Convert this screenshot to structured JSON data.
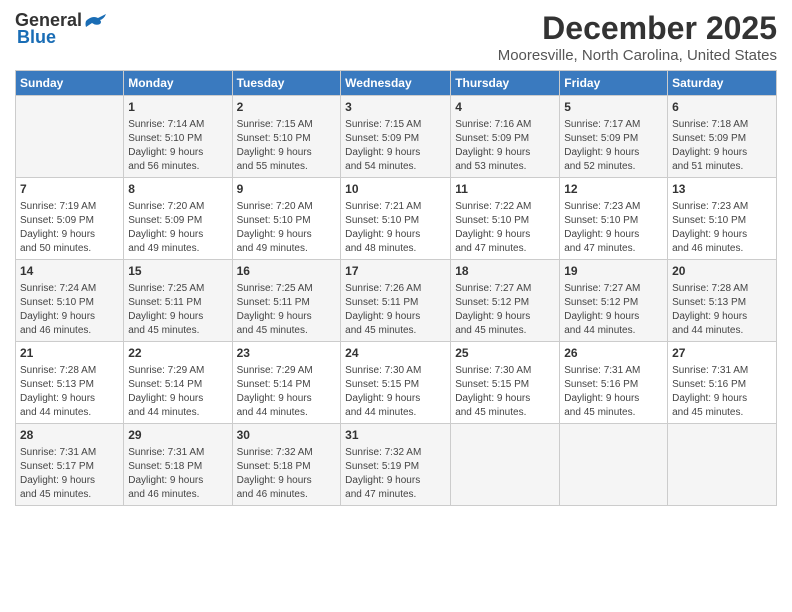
{
  "header": {
    "logo_general": "General",
    "logo_blue": "Blue",
    "month_title": "December 2025",
    "location": "Mooresville, North Carolina, United States"
  },
  "days_of_week": [
    "Sunday",
    "Monday",
    "Tuesday",
    "Wednesday",
    "Thursday",
    "Friday",
    "Saturday"
  ],
  "weeks": [
    [
      {
        "day": "",
        "info": ""
      },
      {
        "day": "1",
        "info": "Sunrise: 7:14 AM\nSunset: 5:10 PM\nDaylight: 9 hours\nand 56 minutes."
      },
      {
        "day": "2",
        "info": "Sunrise: 7:15 AM\nSunset: 5:10 PM\nDaylight: 9 hours\nand 55 minutes."
      },
      {
        "day": "3",
        "info": "Sunrise: 7:15 AM\nSunset: 5:09 PM\nDaylight: 9 hours\nand 54 minutes."
      },
      {
        "day": "4",
        "info": "Sunrise: 7:16 AM\nSunset: 5:09 PM\nDaylight: 9 hours\nand 53 minutes."
      },
      {
        "day": "5",
        "info": "Sunrise: 7:17 AM\nSunset: 5:09 PM\nDaylight: 9 hours\nand 52 minutes."
      },
      {
        "day": "6",
        "info": "Sunrise: 7:18 AM\nSunset: 5:09 PM\nDaylight: 9 hours\nand 51 minutes."
      }
    ],
    [
      {
        "day": "7",
        "info": "Sunrise: 7:19 AM\nSunset: 5:09 PM\nDaylight: 9 hours\nand 50 minutes."
      },
      {
        "day": "8",
        "info": "Sunrise: 7:20 AM\nSunset: 5:09 PM\nDaylight: 9 hours\nand 49 minutes."
      },
      {
        "day": "9",
        "info": "Sunrise: 7:20 AM\nSunset: 5:10 PM\nDaylight: 9 hours\nand 49 minutes."
      },
      {
        "day": "10",
        "info": "Sunrise: 7:21 AM\nSunset: 5:10 PM\nDaylight: 9 hours\nand 48 minutes."
      },
      {
        "day": "11",
        "info": "Sunrise: 7:22 AM\nSunset: 5:10 PM\nDaylight: 9 hours\nand 47 minutes."
      },
      {
        "day": "12",
        "info": "Sunrise: 7:23 AM\nSunset: 5:10 PM\nDaylight: 9 hours\nand 47 minutes."
      },
      {
        "day": "13",
        "info": "Sunrise: 7:23 AM\nSunset: 5:10 PM\nDaylight: 9 hours\nand 46 minutes."
      }
    ],
    [
      {
        "day": "14",
        "info": "Sunrise: 7:24 AM\nSunset: 5:10 PM\nDaylight: 9 hours\nand 46 minutes."
      },
      {
        "day": "15",
        "info": "Sunrise: 7:25 AM\nSunset: 5:11 PM\nDaylight: 9 hours\nand 45 minutes."
      },
      {
        "day": "16",
        "info": "Sunrise: 7:25 AM\nSunset: 5:11 PM\nDaylight: 9 hours\nand 45 minutes."
      },
      {
        "day": "17",
        "info": "Sunrise: 7:26 AM\nSunset: 5:11 PM\nDaylight: 9 hours\nand 45 minutes."
      },
      {
        "day": "18",
        "info": "Sunrise: 7:27 AM\nSunset: 5:12 PM\nDaylight: 9 hours\nand 45 minutes."
      },
      {
        "day": "19",
        "info": "Sunrise: 7:27 AM\nSunset: 5:12 PM\nDaylight: 9 hours\nand 44 minutes."
      },
      {
        "day": "20",
        "info": "Sunrise: 7:28 AM\nSunset: 5:13 PM\nDaylight: 9 hours\nand 44 minutes."
      }
    ],
    [
      {
        "day": "21",
        "info": "Sunrise: 7:28 AM\nSunset: 5:13 PM\nDaylight: 9 hours\nand 44 minutes."
      },
      {
        "day": "22",
        "info": "Sunrise: 7:29 AM\nSunset: 5:14 PM\nDaylight: 9 hours\nand 44 minutes."
      },
      {
        "day": "23",
        "info": "Sunrise: 7:29 AM\nSunset: 5:14 PM\nDaylight: 9 hours\nand 44 minutes."
      },
      {
        "day": "24",
        "info": "Sunrise: 7:30 AM\nSunset: 5:15 PM\nDaylight: 9 hours\nand 44 minutes."
      },
      {
        "day": "25",
        "info": "Sunrise: 7:30 AM\nSunset: 5:15 PM\nDaylight: 9 hours\nand 45 minutes."
      },
      {
        "day": "26",
        "info": "Sunrise: 7:31 AM\nSunset: 5:16 PM\nDaylight: 9 hours\nand 45 minutes."
      },
      {
        "day": "27",
        "info": "Sunrise: 7:31 AM\nSunset: 5:16 PM\nDaylight: 9 hours\nand 45 minutes."
      }
    ],
    [
      {
        "day": "28",
        "info": "Sunrise: 7:31 AM\nSunset: 5:17 PM\nDaylight: 9 hours\nand 45 minutes."
      },
      {
        "day": "29",
        "info": "Sunrise: 7:31 AM\nSunset: 5:18 PM\nDaylight: 9 hours\nand 46 minutes."
      },
      {
        "day": "30",
        "info": "Sunrise: 7:32 AM\nSunset: 5:18 PM\nDaylight: 9 hours\nand 46 minutes."
      },
      {
        "day": "31",
        "info": "Sunrise: 7:32 AM\nSunset: 5:19 PM\nDaylight: 9 hours\nand 47 minutes."
      },
      {
        "day": "",
        "info": ""
      },
      {
        "day": "",
        "info": ""
      },
      {
        "day": "",
        "info": ""
      }
    ]
  ]
}
